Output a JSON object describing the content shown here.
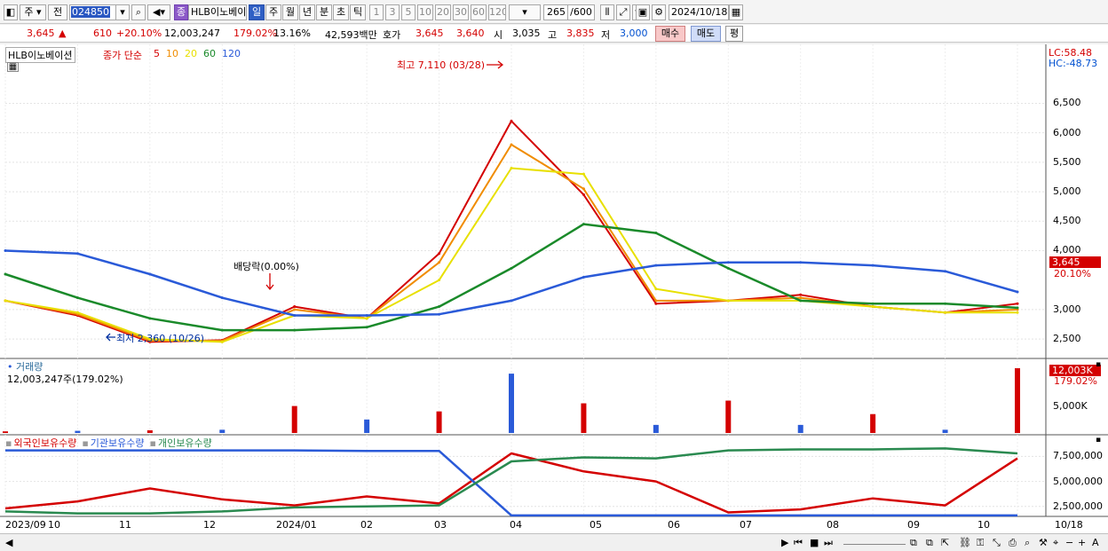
{
  "toolbar": {
    "type_select": "주",
    "prev_label": "전",
    "code": "024850",
    "stock_badge": "종",
    "stock_name": "HLB이노베이",
    "periods": [
      "일",
      "주",
      "월",
      "년",
      "분",
      "초",
      "틱"
    ],
    "active_period": "일",
    "intervals": [
      "1",
      "3",
      "5",
      "10",
      "20",
      "30",
      "60",
      "120"
    ],
    "count": "265",
    "count_max": "/600",
    "date": "2024/10/18"
  },
  "quote": {
    "price": "3,645",
    "change_arrow": "▲",
    "change": "610",
    "change_pct": "+20.10%",
    "volume": "12,003,247",
    "volume_ratio": "179.02%",
    "turnover": "13.16%",
    "amount": "42,593백만",
    "bid_label": "호가",
    "ask": "3,645",
    "bid": "3,640",
    "open_label": "시",
    "open": "3,035",
    "high_label": "고",
    "high": "3,835",
    "low_label": "저",
    "low": "3,000",
    "buy_label": "매수",
    "sell_label": "매도",
    "eval_label": "평"
  },
  "price_panel": {
    "name": "HLB이노베이션",
    "ma_label": "종가 단순",
    "ma_periods": [
      "5",
      "10",
      "20",
      "60",
      "120"
    ],
    "ma_colors": [
      "#d40000",
      "#f08c00",
      "#e8e000",
      "#1a8a2a",
      "#2a5ad8"
    ],
    "lc": "LC:58.48",
    "hc": "HC:-48.73",
    "high_annotation": "최고 7,110 (03/28)",
    "low_annotation": "최저 2,360 (10/26)",
    "dividend_annotation": "배당락(0.00%)",
    "last_price_badge": "3,645",
    "last_pct_badge": "20.10%",
    "y_ticks": [
      "6,500",
      "6,000",
      "5,500",
      "5,000",
      "4,500",
      "4,000",
      "3,000",
      "2,500"
    ]
  },
  "volume_panel": {
    "title": "거래량",
    "value_text": "12,003,247주(179.02%)",
    "badge": "12,003K",
    "badge_pct": "179.02%",
    "y_tick": "5,000K"
  },
  "holding_panel": {
    "legend": [
      "외국인보유수량",
      "기관보유수량",
      "개인보유수량"
    ],
    "legend_colors": [
      "#d40000",
      "#2a5ad8",
      "#2a8a50"
    ],
    "y_ticks": [
      "7,500,000",
      "5,000,000",
      "2,500,000"
    ]
  },
  "x_axis": {
    "labels": [
      "2023/09",
      "10",
      "11",
      "12",
      "2024/01",
      "02",
      "03",
      "04",
      "05",
      "06",
      "07",
      "08",
      "09",
      "10",
      "10/18"
    ]
  },
  "chart_data": {
    "type": "line",
    "title": "HLB이노베이션",
    "x": [
      "2023/09",
      "10",
      "11",
      "12",
      "2024/01",
      "02",
      "03",
      "04",
      "05",
      "06",
      "07",
      "08",
      "09",
      "10",
      "10/18"
    ],
    "series": [
      {
        "name": "5",
        "values": [
          3150,
          2900,
          2450,
          2480,
          3050,
          2850,
          3950,
          6200,
          4950,
          3100,
          3150,
          3250,
          3050,
          2950,
          3100
        ]
      },
      {
        "name": "10",
        "values": [
          3150,
          2920,
          2470,
          2470,
          3000,
          2850,
          3800,
          5800,
          5050,
          3150,
          3150,
          3200,
          3050,
          2950,
          3000
        ]
      },
      {
        "name": "20",
        "values": [
          3150,
          2950,
          2500,
          2450,
          2900,
          2850,
          3500,
          5400,
          5300,
          3350,
          3150,
          3150,
          3050,
          2950,
          2950
        ]
      },
      {
        "name": "60",
        "values": [
          3600,
          3200,
          2850,
          2650,
          2650,
          2700,
          3050,
          3700,
          4450,
          4300,
          3700,
          3150,
          3100,
          3100,
          3030
        ]
      },
      {
        "name": "120",
        "values": [
          4000,
          3950,
          3600,
          3200,
          2900,
          2900,
          2920,
          3150,
          3550,
          3750,
          3800,
          3800,
          3750,
          3650,
          3300
        ]
      }
    ],
    "volume_k": [
      300,
      400,
      500,
      600,
      5000,
      2500,
      4000,
      11000,
      5500,
      1500,
      6000,
      1500,
      3500,
      600,
      12003
    ],
    "holdings": [
      {
        "name": "외국인보유수량",
        "values": [
          2300000,
          3000000,
          4300000,
          3200000,
          2600000,
          3500000,
          2800000,
          7800000,
          6000000,
          5000000,
          1900000,
          2200000,
          3300000,
          2600000,
          7300000
        ]
      },
      {
        "name": "기관보유수량",
        "values": [
          8100000,
          8100000,
          8100000,
          8100000,
          8100000,
          8050000,
          8050000,
          1600000,
          1600000,
          1600000,
          1600000,
          1600000,
          1600000,
          1600000,
          1600000
        ]
      },
      {
        "name": "개인보유수량",
        "values": [
          2000000,
          1800000,
          1800000,
          2000000,
          2400000,
          2500000,
          2600000,
          7000000,
          7400000,
          7300000,
          8100000,
          8200000,
          8200000,
          8300000,
          7800000
        ]
      }
    ],
    "ylim_price": [
      2200,
      7200
    ],
    "ylim_volume_k": [
      0,
      12500
    ],
    "ylim_holdings": [
      1500000,
      8600000
    ],
    "grid": true
  }
}
